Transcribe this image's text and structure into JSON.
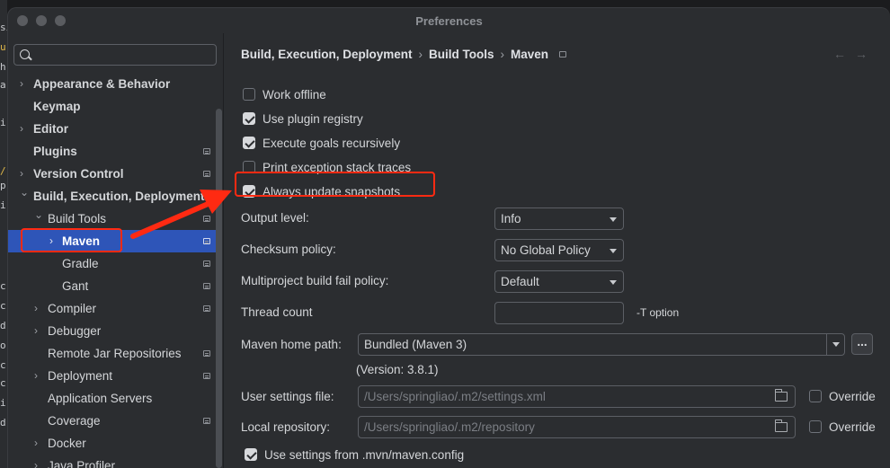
{
  "window": {
    "title": "Preferences"
  },
  "left_edge_chars": [
    "si",
    "u",
    "h",
    "a",
    "",
    "i",
    "",
    "/",
    "p",
    "i",
    "",
    "",
    "c",
    "c",
    "d",
    "o",
    "c",
    "c",
    "i",
    "d"
  ],
  "sidebar": {
    "search_placeholder": "",
    "items": [
      {
        "label": "Appearance & Behavior",
        "arrow": "›"
      },
      {
        "label": "Keymap",
        "arrow": ""
      },
      {
        "label": "Editor",
        "arrow": "›"
      },
      {
        "label": "Plugins",
        "arrow": ""
      },
      {
        "label": "Version Control",
        "arrow": "›"
      },
      {
        "label": "Build, Execution, Deployment",
        "arrow": "⌄"
      },
      {
        "label": "Build Tools",
        "arrow": "⌄"
      },
      {
        "label": "Maven",
        "arrow": "›"
      },
      {
        "label": "Gradle",
        "arrow": ""
      },
      {
        "label": "Gant",
        "arrow": ""
      },
      {
        "label": "Compiler",
        "arrow": "›"
      },
      {
        "label": "Debugger",
        "arrow": "›"
      },
      {
        "label": "Remote Jar Repositories",
        "arrow": ""
      },
      {
        "label": "Deployment",
        "arrow": "›"
      },
      {
        "label": "Application Servers",
        "arrow": ""
      },
      {
        "label": "Coverage",
        "arrow": ""
      },
      {
        "label": "Docker",
        "arrow": "›"
      },
      {
        "label": "Java Profiler",
        "arrow": "›"
      }
    ]
  },
  "breadcrumb": {
    "part1": "Build, Execution, Deployment",
    "part2": "Build Tools",
    "part3": "Maven",
    "sep": "›",
    "back": "←",
    "forward": "→"
  },
  "options": {
    "work_offline": {
      "label": "Work offline",
      "checked": false
    },
    "plugin_registry": {
      "label": "Use plugin registry",
      "checked": true
    },
    "goals_recursive": {
      "label": "Execute goals recursively",
      "checked": true
    },
    "stack_traces": {
      "label": "Print exception stack traces",
      "checked": false
    },
    "update_snapshots": {
      "label": "Always update snapshots",
      "checked": true
    }
  },
  "fields": {
    "output_level": {
      "label": "Output level:",
      "value": "Info"
    },
    "checksum_policy": {
      "label": "Checksum policy:",
      "value": "No Global Policy"
    },
    "fail_policy": {
      "label": "Multiproject build fail policy:",
      "value": "Default"
    },
    "thread_count": {
      "label": "Thread count",
      "value": "",
      "suffix": "-T option"
    },
    "maven_home": {
      "label": "Maven home path:",
      "value": "Bundled (Maven 3)",
      "button": "...",
      "version": "(Version: 3.8.1)"
    },
    "user_settings": {
      "label": "User settings file:",
      "value": "/Users/springliao/.m2/settings.xml",
      "override": "Override"
    },
    "local_repo": {
      "label": "Local repository:",
      "value": "/Users/springliao/.m2/repository",
      "override": "Override"
    },
    "mvn_config": {
      "label": "Use settings from .mvn/maven.config",
      "checked": true
    }
  },
  "colors": {
    "accent_selection": "#2e55b8",
    "annotation": "#ff2a12"
  }
}
